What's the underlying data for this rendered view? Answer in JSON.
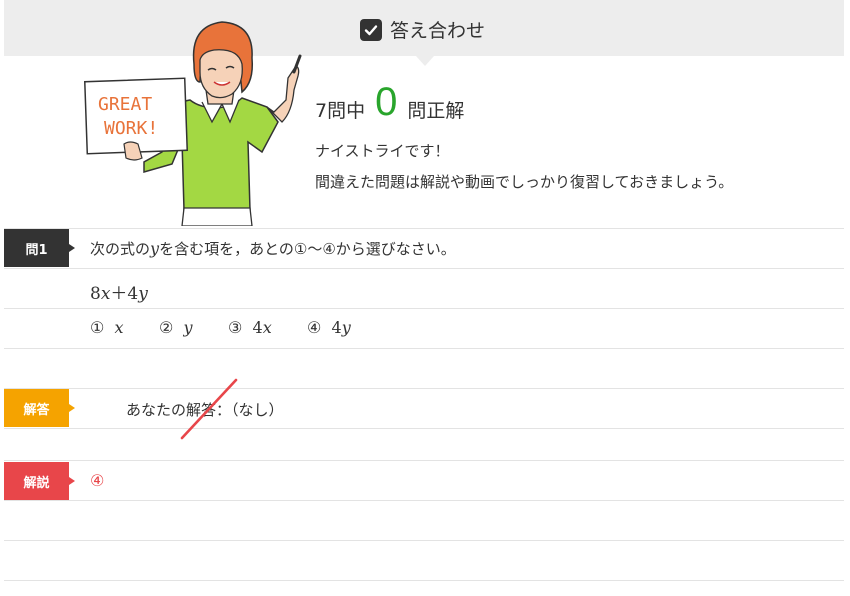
{
  "header": {
    "title": "答え合わせ"
  },
  "score": {
    "prefix": "7問中",
    "correct": "0",
    "suffix": "問正解"
  },
  "message": {
    "line1": "ナイストライです！",
    "line2": "間違えた問題は解説や動画でしっかり復習しておきましょう。"
  },
  "illustration": {
    "sign_line1": "GREAT",
    "sign_line2": "WORK!"
  },
  "question": {
    "label": "問1",
    "text_before": "次の式の",
    "var": "y",
    "text_after": "を含む項を，あとの①〜④から選びなさい。",
    "expression_a": "8",
    "expression_x": "x",
    "expression_b": "＋4",
    "expression_y": "y",
    "choices": [
      {
        "num": "①",
        "coef": "",
        "var": "x"
      },
      {
        "num": "②",
        "coef": "",
        "var": "y"
      },
      {
        "num": "③",
        "coef": "4",
        "var": "x"
      },
      {
        "num": "④",
        "coef": "4",
        "var": "y"
      }
    ]
  },
  "answer": {
    "label": "解答",
    "text": "あなたの解答：（なし）"
  },
  "explanation": {
    "label": "解説",
    "text": "④"
  },
  "colors": {
    "correct_count": "#29a52c",
    "answer_label": "#f5a300",
    "explanation_label": "#e8464a",
    "question_label": "#333333"
  }
}
